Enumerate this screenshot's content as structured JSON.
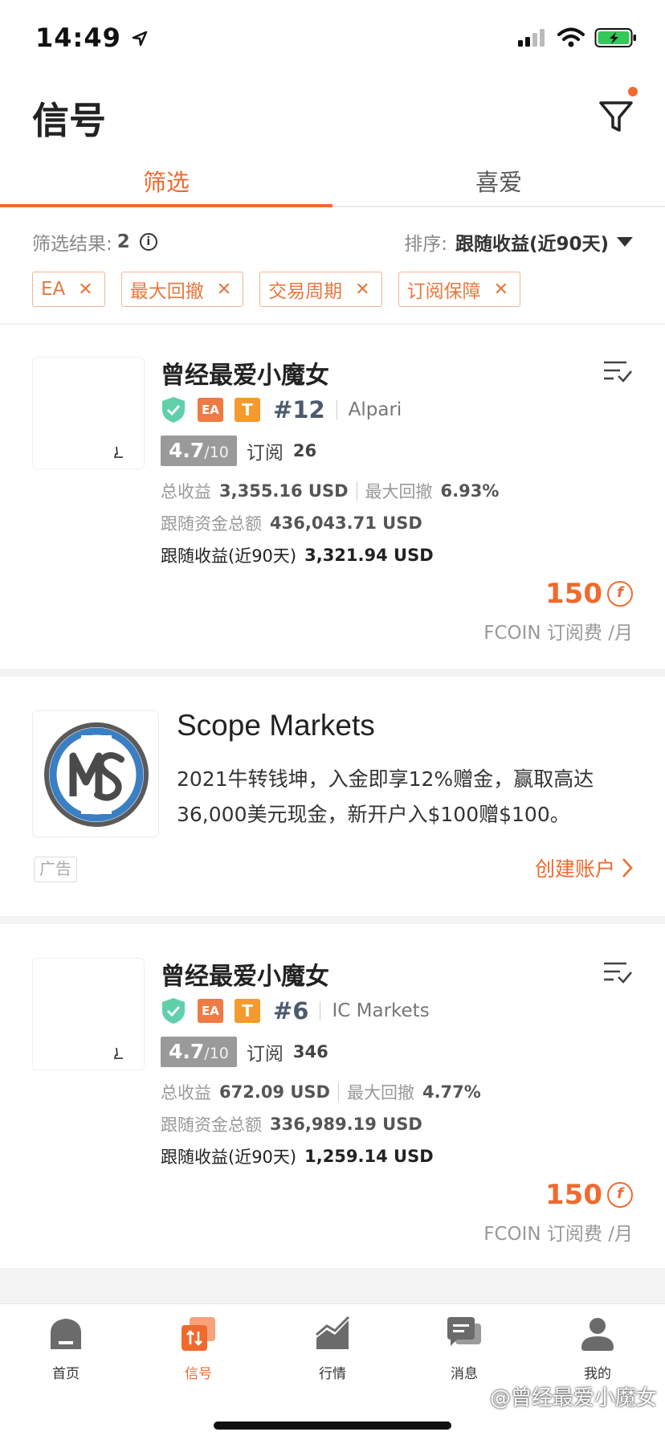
{
  "status_bar": {
    "time": "14:49"
  },
  "header": {
    "title": "信号"
  },
  "tabs": [
    {
      "label": "筛选",
      "active": true
    },
    {
      "label": "喜爱",
      "active": false
    }
  ],
  "results": {
    "label": "筛选结果:",
    "count": "2",
    "sort_label": "排序:",
    "sort_value": "跟随收益(近90天)"
  },
  "chips": [
    {
      "label": "EA"
    },
    {
      "label": "最大回撤"
    },
    {
      "label": "交易周期"
    },
    {
      "label": "订阅保障"
    }
  ],
  "signals": [
    {
      "name": "曾经最爱小魔女",
      "badge_ea": "EA",
      "badge_t": "T",
      "rank": "#12",
      "broker": "Alpari",
      "score": "4.7",
      "score_total": "/10",
      "subs_label": "订阅",
      "subs": "26",
      "total_profit_label": "总收益",
      "total_profit": "3,355.16 USD",
      "max_dd_label": "最大回撤",
      "max_dd": "6.93%",
      "follow_funds_label": "跟随资金总额",
      "follow_funds": "436,043.71 USD",
      "follow_profit_label": "跟随收益(近90天)",
      "follow_profit": "3,321.94 USD",
      "price": "150",
      "price_unit": "FCOIN 订阅费 /月"
    },
    {
      "name": "曾经最爱小魔女",
      "badge_ea": "EA",
      "badge_t": "T",
      "rank": "#6",
      "broker": "IC Markets",
      "score": "4.7",
      "score_total": "/10",
      "subs_label": "订阅",
      "subs": "346",
      "total_profit_label": "总收益",
      "total_profit": "672.09 USD",
      "max_dd_label": "最大回撤",
      "max_dd": "4.77%",
      "follow_funds_label": "跟随资金总额",
      "follow_funds": "336,989.19 USD",
      "follow_profit_label": "跟随收益(近90天)",
      "follow_profit": "1,259.14 USD",
      "price": "150",
      "price_unit": "FCOIN 订阅费 /月"
    }
  ],
  "ad": {
    "title": "Scope Markets",
    "description": "2021牛转钱坤，入金即享12%赠金，赢取高达36,000美元现金，新开户入$100赠$100。",
    "tag": "广告",
    "cta": "创建账户"
  },
  "bottom_nav": [
    {
      "label": "首页",
      "icon": "home-icon"
    },
    {
      "label": "信号",
      "icon": "signal-icon",
      "active": true
    },
    {
      "label": "行情",
      "icon": "chart-icon"
    },
    {
      "label": "消息",
      "icon": "message-icon"
    },
    {
      "label": "我的",
      "icon": "profile-icon"
    }
  ],
  "watermark": "@曾经最爱小魔女",
  "colors": {
    "accent": "#f06a2e",
    "verified": "#5fd0a7",
    "badge_t": "#f59a2c"
  }
}
